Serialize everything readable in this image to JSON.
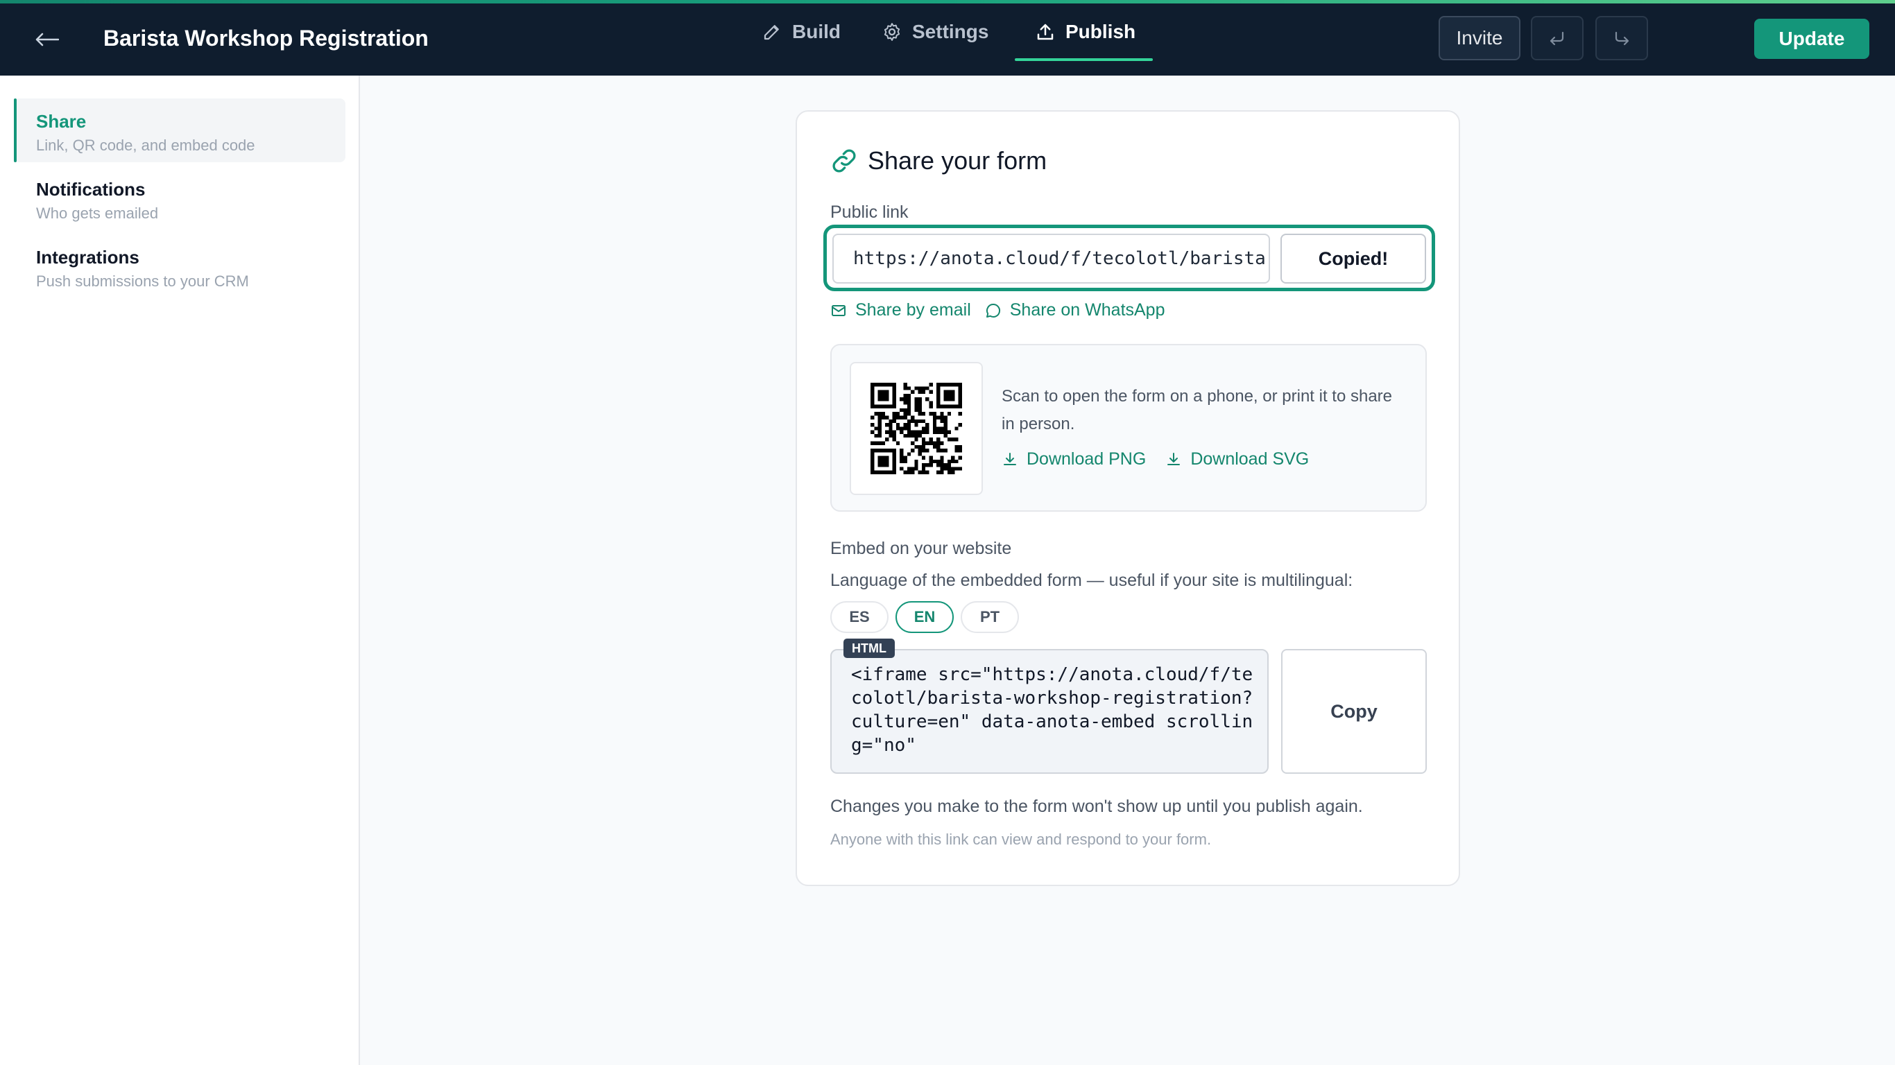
{
  "header": {
    "title": "Barista Workshop Registration",
    "tabs": [
      {
        "label": "Build",
        "icon": "pencil-icon"
      },
      {
        "label": "Settings",
        "icon": "gear-icon"
      },
      {
        "label": "Publish",
        "icon": "upload-icon",
        "active": true
      }
    ],
    "invite_label": "Invite",
    "update_label": "Update"
  },
  "sidebar": {
    "items": [
      {
        "title": "Share",
        "subtitle": "Link, QR code, and embed code",
        "active": true
      },
      {
        "title": "Notifications",
        "subtitle": "Who gets emailed"
      },
      {
        "title": "Integrations",
        "subtitle": "Push submissions to your CRM"
      }
    ]
  },
  "card": {
    "title": "Share your form",
    "public_link_label": "Public link",
    "public_link_value": "https://anota.cloud/f/tecolotl/barista-workshop-registration",
    "copied_label": "Copied!",
    "share_email": "Share by email",
    "share_whatsapp": "Share on WhatsApp",
    "qr_text": "Scan to open the form on a phone, or print it to share in person.",
    "download_png": "Download PNG",
    "download_svg": "Download SVG",
    "embed_title": "Embed on your website",
    "embed_lang_text": "Language of the embedded form — useful if your site is multilingual:",
    "languages": [
      "ES",
      "EN",
      "PT"
    ],
    "selected_language": "EN",
    "code_tag": "HTML",
    "embed_code": "<iframe src=\"https://anota.cloud/f/tecolotl/barista-workshop-registration?culture=en\" data-anota-embed scrolling=\"no\"",
    "copy_label": "Copy",
    "note": "Changes you make to the form won't show up until you publish again.",
    "note_small": "Anyone with this link can view and respond to your form."
  },
  "colors": {
    "header_bg": "#0f1d2e",
    "accent": "#14967a",
    "accent_text": "#14866d"
  }
}
